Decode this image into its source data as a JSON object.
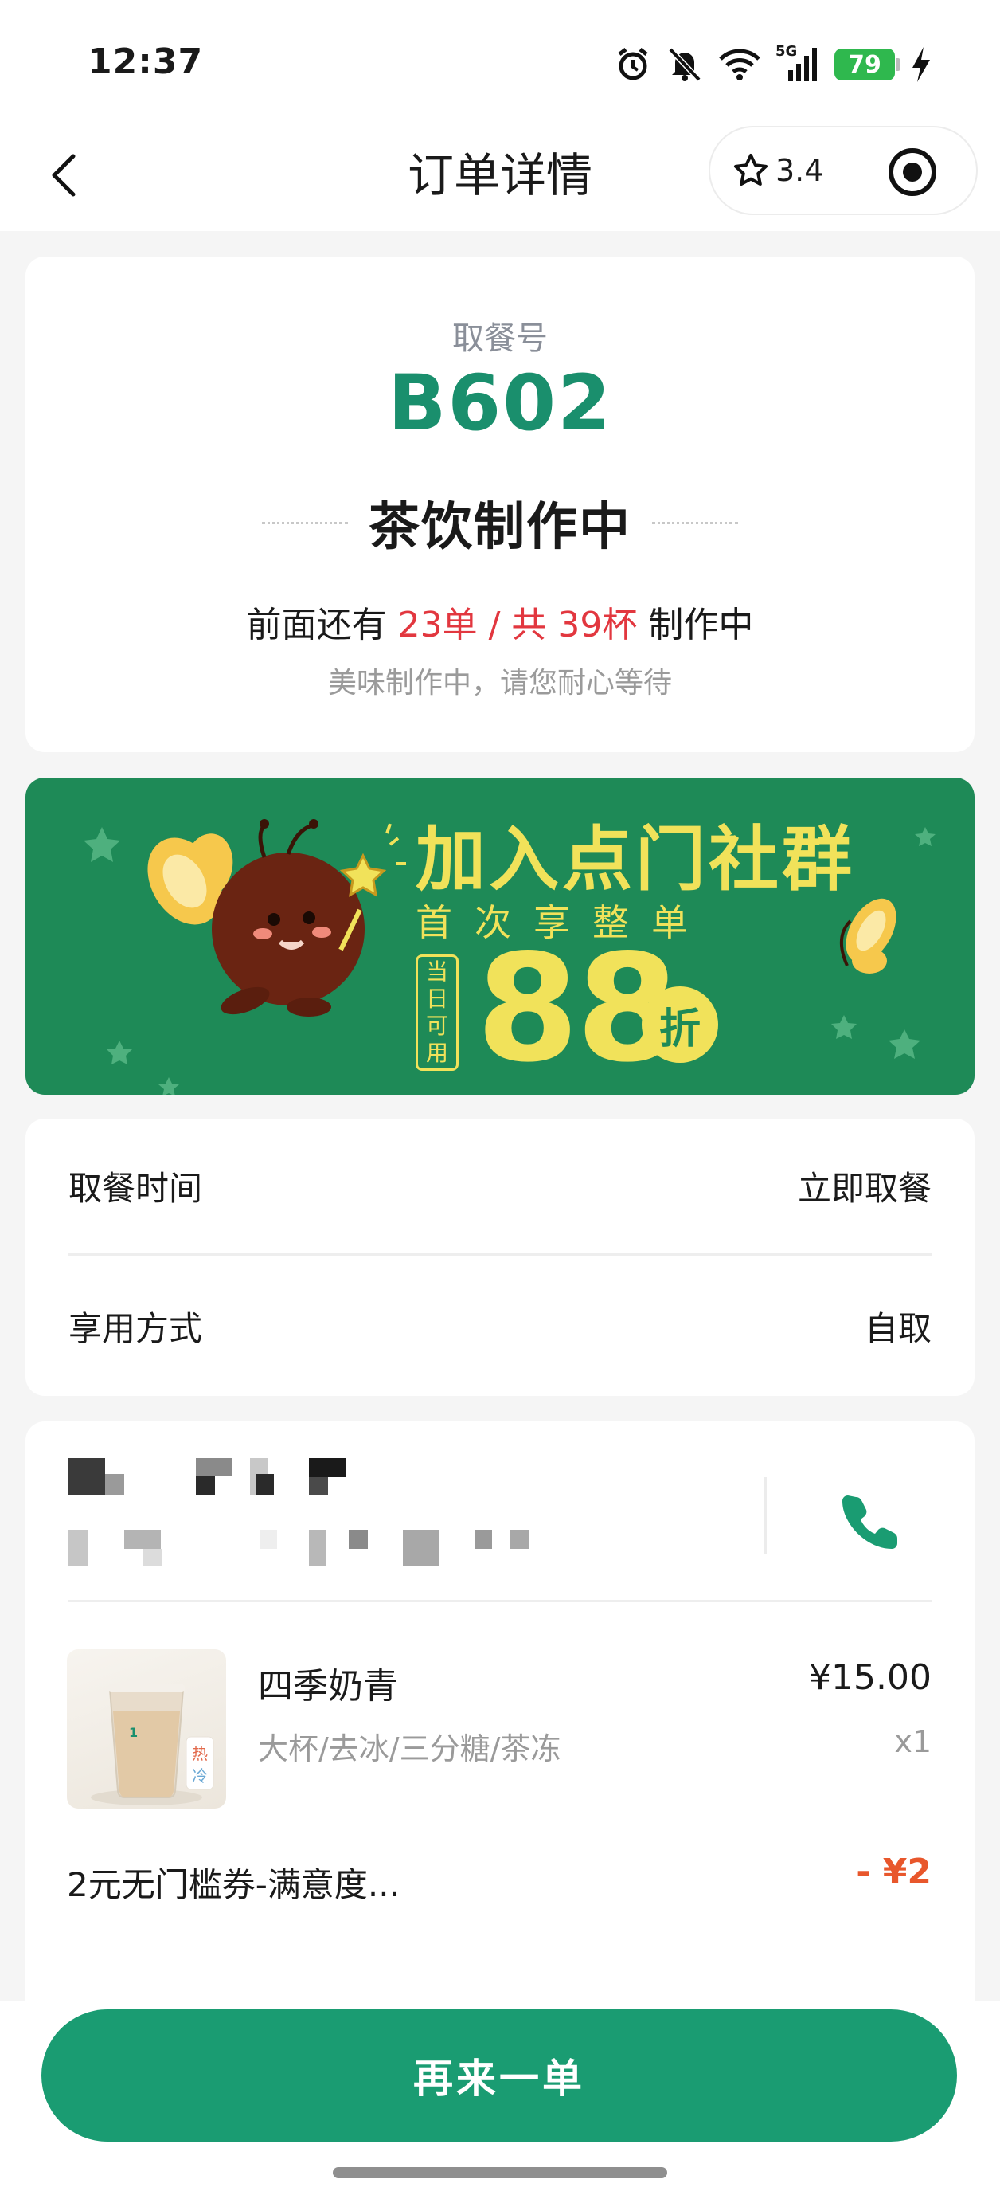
{
  "status_bar": {
    "time": "12:37",
    "network": "5G",
    "battery": "79"
  },
  "nav": {
    "title": "订单详情",
    "rating": "3.4"
  },
  "pickup": {
    "label": "取餐号",
    "number": "B602",
    "status": "茶饮制作中",
    "queue_prefix": "前面还有",
    "queue_orders": "23单",
    "queue_sep": " / ",
    "queue_cups": "共 39杯",
    "queue_suffix": "制作中",
    "queue_sub": "美味制作中，请您耐心等待"
  },
  "banner": {
    "title": "加入点门社群",
    "subtitle": "首次享整单",
    "tag": "当日可用",
    "discount": "88",
    "discount_unit": "折"
  },
  "info": {
    "pickup_time_label": "取餐时间",
    "pickup_time_value": "立即取餐",
    "usage_label": "享用方式",
    "usage_value": "自取"
  },
  "order": {
    "item": {
      "name": "四季奶青",
      "spec": "大杯/去冰/三分糖/茶冻",
      "price": "¥15.00",
      "qty": "x1",
      "cup_hot": "热",
      "cup_cold": "冷"
    },
    "coupon_label": "2元无门槛券-满意度...",
    "coupon_value": "- ¥2"
  },
  "bottom": {
    "reorder_label": "再来一单"
  },
  "colors": {
    "brand_green": "#1a9c72",
    "banner_green": "#1e8a57",
    "highlight_red": "#e2373f",
    "discount_orange": "#e8572c"
  }
}
